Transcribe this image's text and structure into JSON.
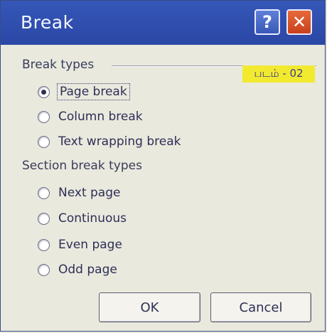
{
  "window": {
    "title": "Break"
  },
  "titlebar": {
    "help_symbol": "?",
    "close_symbol": "✕"
  },
  "break_types": {
    "label": "Break types",
    "tag": "படம் - 02",
    "options": [
      {
        "label": "Page break",
        "checked": true
      },
      {
        "label": "Column break",
        "checked": false
      },
      {
        "label": "Text wrapping break",
        "checked": false
      }
    ]
  },
  "section_break_types": {
    "label": "Section break types",
    "options": [
      {
        "label": "Next page",
        "checked": false
      },
      {
        "label": "Continuous",
        "checked": false
      },
      {
        "label": "Even page",
        "checked": false
      },
      {
        "label": "Odd page",
        "checked": false
      }
    ]
  },
  "buttons": {
    "ok": "OK",
    "cancel": "Cancel"
  }
}
